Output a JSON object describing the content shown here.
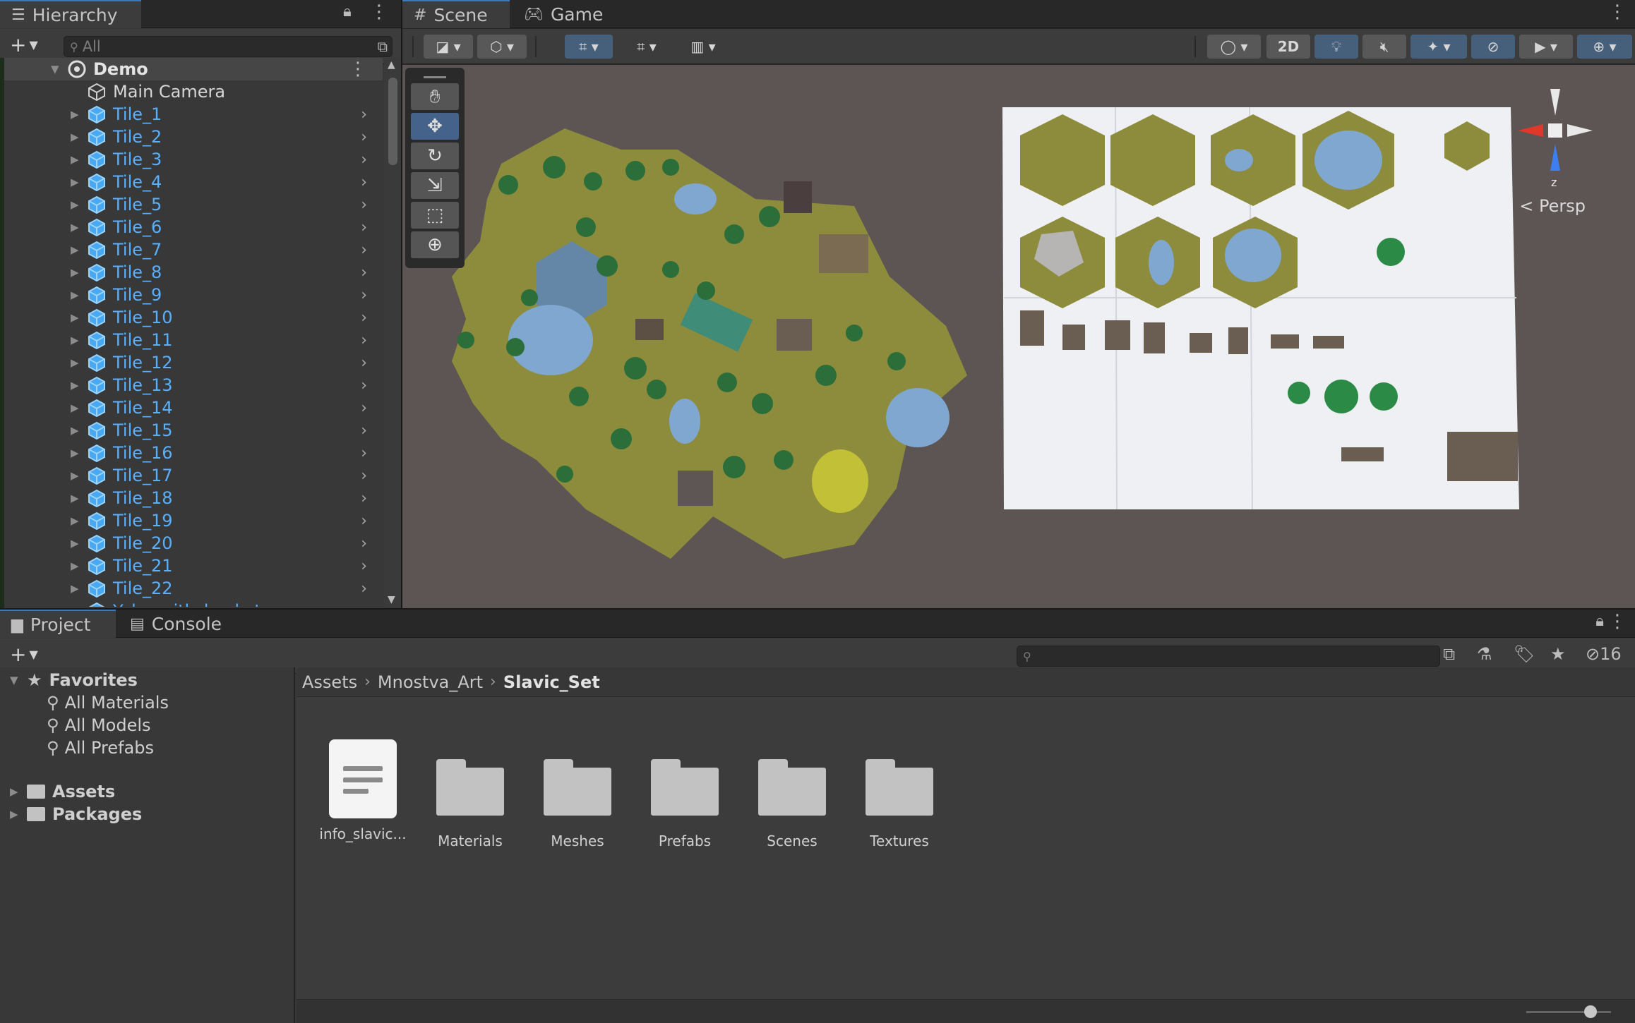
{
  "hierarchy": {
    "tab_label": "Hierarchy",
    "search_placeholder": "All",
    "root": {
      "label": "Demo"
    },
    "items": [
      {
        "label": "Main Camera",
        "type": "camera"
      },
      {
        "label": "Tile_1",
        "type": "prefab"
      },
      {
        "label": "Tile_2",
        "type": "prefab"
      },
      {
        "label": "Tile_3",
        "type": "prefab"
      },
      {
        "label": "Tile_4",
        "type": "prefab"
      },
      {
        "label": "Tile_5",
        "type": "prefab"
      },
      {
        "label": "Tile_6",
        "type": "prefab"
      },
      {
        "label": "Tile_7",
        "type": "prefab"
      },
      {
        "label": "Tile_8",
        "type": "prefab"
      },
      {
        "label": "Tile_9",
        "type": "prefab"
      },
      {
        "label": "Tile_10",
        "type": "prefab"
      },
      {
        "label": "Tile_11",
        "type": "prefab"
      },
      {
        "label": "Tile_12",
        "type": "prefab"
      },
      {
        "label": "Tile_13",
        "type": "prefab"
      },
      {
        "label": "Tile_14",
        "type": "prefab"
      },
      {
        "label": "Tile_15",
        "type": "prefab"
      },
      {
        "label": "Tile_16",
        "type": "prefab"
      },
      {
        "label": "Tile_17",
        "type": "prefab"
      },
      {
        "label": "Tile_18",
        "type": "prefab"
      },
      {
        "label": "Tile_19",
        "type": "prefab"
      },
      {
        "label": "Tile_20",
        "type": "prefab"
      },
      {
        "label": "Tile_21",
        "type": "prefab"
      },
      {
        "label": "Tile_22",
        "type": "prefab"
      },
      {
        "label": "Yoke_with_buckets",
        "type": "prefab"
      }
    ]
  },
  "scene": {
    "tabs": [
      {
        "label": "Scene",
        "icon": "grid-icon"
      },
      {
        "label": "Game",
        "icon": "gamepad-icon"
      }
    ],
    "mode_2d_label": "2D",
    "persp_label": "< Persp",
    "gizmo_axis_label": "z"
  },
  "project": {
    "tabs": [
      {
        "label": "Project",
        "icon": "folder-icon"
      },
      {
        "label": "Console",
        "icon": "console-icon"
      }
    ],
    "hidden_count": "16",
    "favorites": {
      "label": "Favorites",
      "items": [
        "All Materials",
        "All Models",
        "All Prefabs"
      ]
    },
    "roots": [
      "Assets",
      "Packages"
    ],
    "breadcrumb": [
      "Assets",
      "Mnostva_Art",
      "Slavic_Set"
    ],
    "assets": [
      {
        "label": "info_slavic...",
        "type": "document"
      },
      {
        "label": "Materials",
        "type": "folder"
      },
      {
        "label": "Meshes",
        "type": "folder"
      },
      {
        "label": "Prefabs",
        "type": "folder"
      },
      {
        "label": "Scenes",
        "type": "folder"
      },
      {
        "label": "Textures",
        "type": "folder"
      }
    ]
  },
  "colors": {
    "accent": "#3a79bb",
    "prefab_text": "#5ab0ff",
    "terrain": "#8d8c3c",
    "water": "#7fa7cf",
    "viewport_bg": "#5c5553"
  }
}
